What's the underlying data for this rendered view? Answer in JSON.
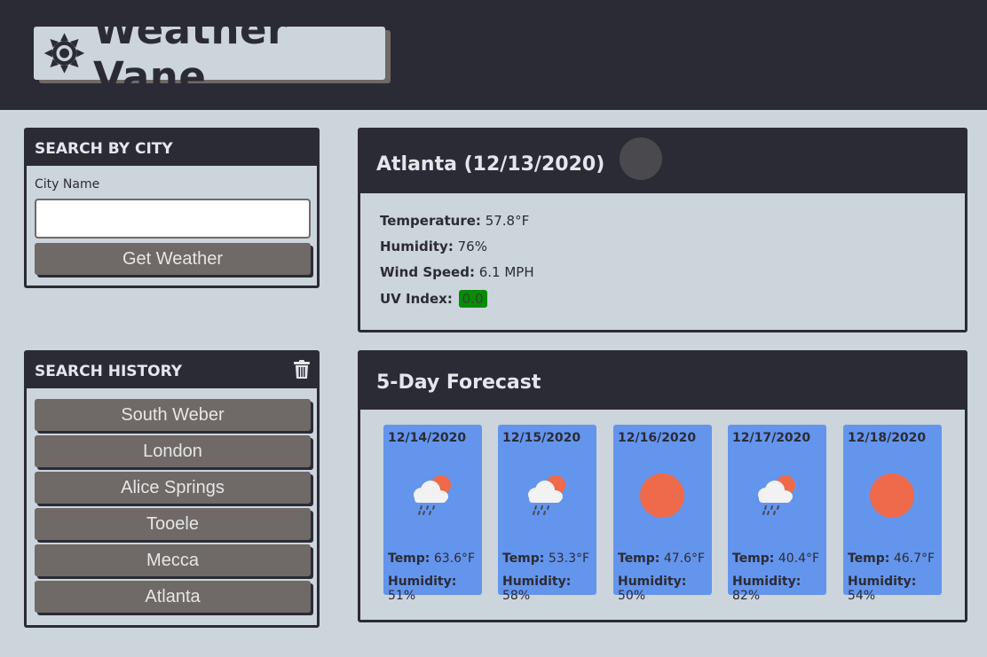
{
  "header": {
    "title": "Weather Vane",
    "icon": "sun-gear-icon"
  },
  "search": {
    "heading": "SEARCH BY CITY",
    "label": "City Name",
    "value": "",
    "placeholder": "",
    "button": "Get Weather"
  },
  "history": {
    "heading": "SEARCH HISTORY",
    "clear_icon": "trash-icon",
    "items": [
      "South Weber",
      "London",
      "Alice Springs",
      "Tooele",
      "Mecca",
      "Atlanta"
    ]
  },
  "current": {
    "title": "Atlanta (12/13/2020)",
    "icon": "weather-icon",
    "temp_label": "Temperature:",
    "temp": "57.8°F",
    "humidity_label": "Humidity:",
    "humidity": "76%",
    "wind_label": "Wind Speed:",
    "wind": "6.1 MPH",
    "uv_label": "UV Index:",
    "uv": "0.0",
    "uv_color": "#0a8a0a"
  },
  "forecast": {
    "title": "5-Day Forecast",
    "temp_label": "Temp:",
    "humidity_label": "Humidity:",
    "days": [
      {
        "date": "12/14/2020",
        "icon": "rain-cloud-sun-icon",
        "temp": "63.6°F",
        "humidity": "51%"
      },
      {
        "date": "12/15/2020",
        "icon": "rain-cloud-sun-icon",
        "temp": "53.3°F",
        "humidity": "58%"
      },
      {
        "date": "12/16/2020",
        "icon": "sun-icon",
        "temp": "47.6°F",
        "humidity": "50%"
      },
      {
        "date": "12/17/2020",
        "icon": "rain-cloud-sun-icon",
        "temp": "40.4°F",
        "humidity": "82%"
      },
      {
        "date": "12/18/2020",
        "icon": "sun-icon",
        "temp": "46.7°F",
        "humidity": "54%"
      }
    ]
  },
  "colors": {
    "dark": "#2b2b36",
    "background": "#ccd5dc",
    "button": "#6f6967",
    "forecast_card": "#6495ed",
    "sun": "#ee6a4a"
  }
}
